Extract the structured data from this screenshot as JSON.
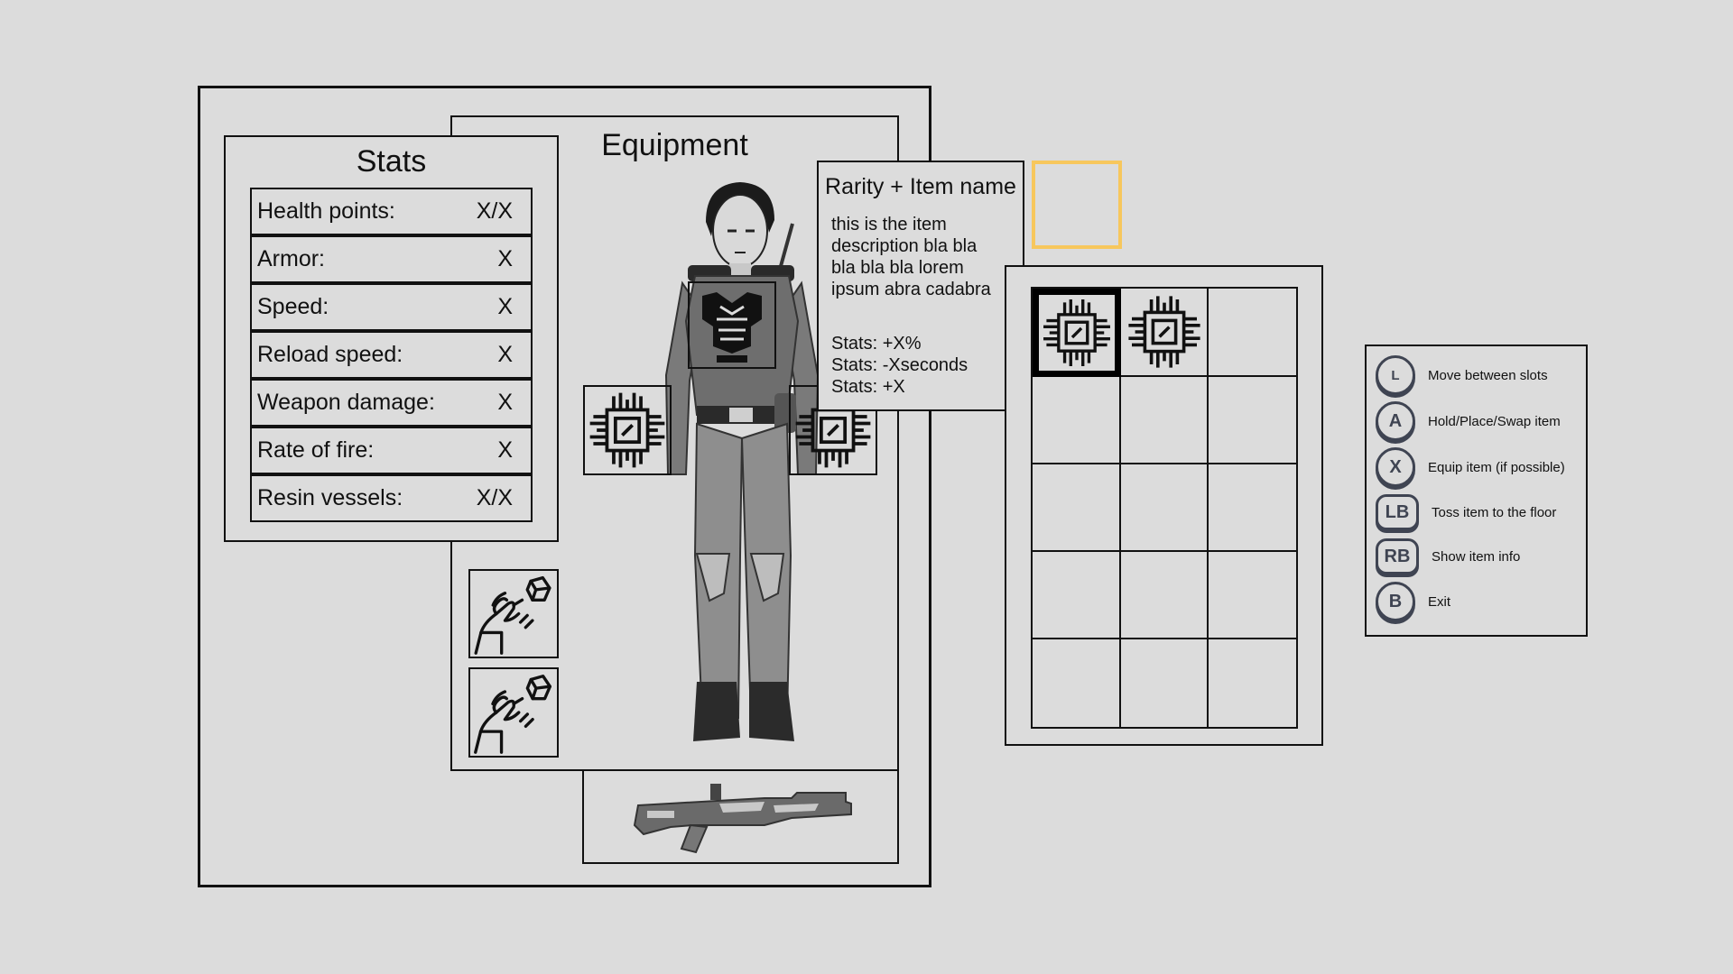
{
  "equipment": {
    "title": "Equipment"
  },
  "stats": {
    "title": "Stats",
    "rows": [
      {
        "label": "Health points:",
        "value": "X/X"
      },
      {
        "label": "Armor:",
        "value": "X"
      },
      {
        "label": "Speed:",
        "value": "X"
      },
      {
        "label": "Reload speed:",
        "value": "X"
      },
      {
        "label": "Weapon damage:",
        "value": "X"
      },
      {
        "label": "Rate of fire:",
        "value": "X"
      },
      {
        "label": "Resin vessels:",
        "value": "X/X"
      }
    ]
  },
  "tooltip": {
    "title": "Rarity + Item name",
    "description": [
      "this is the item",
      "description bla bla",
      "bla bla bla lorem",
      "ipsum abra cadabra"
    ],
    "stats": [
      "Stats: +X%",
      "Stats: -Xseconds",
      "Stats: +X"
    ]
  },
  "inventory": {
    "filled_slots": [
      0,
      1
    ],
    "selected_slot": 0,
    "item_icon": "chip-icon"
  },
  "controls": [
    {
      "button": "L",
      "icon": "left-stick-icon",
      "label": "Move between slots"
    },
    {
      "button": "A",
      "icon": "a-button-icon",
      "label": "Hold/Place/Swap item"
    },
    {
      "button": "X",
      "icon": "x-button-icon",
      "label": "Equip item (if possible)"
    },
    {
      "button": "LB",
      "icon": "lb-button-icon",
      "label": "Toss item to the floor"
    },
    {
      "button": "RB",
      "icon": "rb-button-icon",
      "label": "Show item info"
    },
    {
      "button": "B",
      "icon": "b-button-icon",
      "label": "Exit"
    }
  ],
  "colors": {
    "background": "#dcdcdc",
    "border": "#111111",
    "highlight": "#f7c75d",
    "button": "#3f4452"
  }
}
